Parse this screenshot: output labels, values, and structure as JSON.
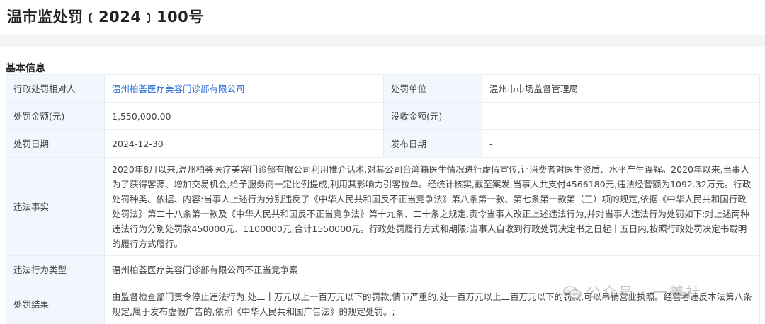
{
  "header": {
    "title": "温市监处罚﹝2024﹞100号"
  },
  "section": {
    "title": "基本信息"
  },
  "table": {
    "party_label": "行政处罚相对人",
    "party_value": "温州柏荟医疗美容门诊部有限公司",
    "unit_label": "处罚单位",
    "unit_value": "温州市市场监督管理局",
    "amount_label": "处罚金额(元)",
    "amount_value": "1,550,000.00",
    "confiscation_label": "没收金额(元)",
    "confiscation_value": "-",
    "date_label": "处罚日期",
    "date_value": "2024-12-30",
    "publish_label": "发布日期",
    "publish_value": "-",
    "facts_label": "违法事实",
    "facts_value": "2020年8月以来,温州柏荟医疗美容门诊部有限公司利用推介话术,对其公司台湾籍医生情况进行虚假宣传,让消费者对医生资质、水平产生误解。2020年以来,当事人为了获得客源、增加交易机会,给予服务商一定比例提成,利用其影响力引客拉单。经统计核实,截至案发,当事人共支付4566180元,违法经营额为1092.32万元。行政处罚种类、依据、内容:当事人上述行为分别违反了《中华人民共和国反不正当竞争法》第八条第一款、第七条第一款第（三）项的规定,依据《中华人民共和国行政处罚法》第二十八条第一款及《中华人民共和国反不正当竞争法》第十九条、二十条之规定,责令当事人改正上述违法行为,并对当事人违法行为处罚如下:对上述两种违法行为分别处罚款450000元、1100000元,合计1550000元。行政处罚履行方式和期限:当事人自收到行政处罚决定书之日起十五日内,按照行政处罚决定书载明的履行方式履行。",
    "type_label": "违法行为类型",
    "type_value": "温州柏荟医疗美容门诊部有限公司不正当竞争案",
    "result_label": "处罚结果",
    "result_value": "由监督检查部门责令停止违法行为,处二十万元以上一百万元以下的罚款;情节严重的,处一百万元以上二百万元以下的罚款,可以吊销营业执照。经营者违反本法第八条规定,属于发布虚假广告的,依照《中华人民共和国广告法》的规定处罚。;"
  },
  "watermark": {
    "text": "公众号 · 一美社",
    "icon": "wechat-icon"
  }
}
